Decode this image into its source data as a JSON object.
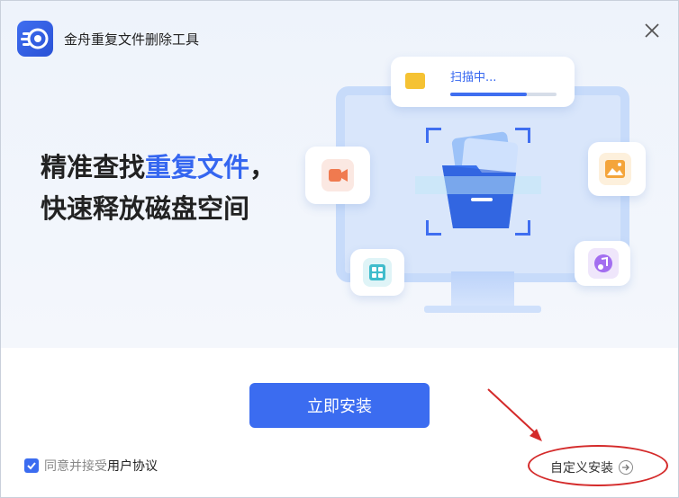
{
  "window": {
    "app_title": "金舟重复文件删除工具"
  },
  "hero": {
    "headline_line1_prefix": "精准查找",
    "headline_line1_highlight": "重复文件",
    "headline_line1_suffix": "，",
    "headline_line2": "快速释放磁盘空间"
  },
  "illustration": {
    "scan_status": "扫描中...",
    "scan_progress_fraction": 0.72
  },
  "actions": {
    "install_label": "立即安装",
    "agree_text": "同意并接受",
    "agree_link": "用户协议",
    "agree_checked": true,
    "custom_install_label": "自定义安装"
  },
  "colors": {
    "accent": "#3b6cf0",
    "annotation": "#d42a2a"
  },
  "icons": [
    "app-logo-icon",
    "close-icon",
    "folder-icon",
    "video-icon",
    "image-icon",
    "apps-icon",
    "music-icon",
    "check-icon",
    "arrow-right-circle-icon"
  ]
}
